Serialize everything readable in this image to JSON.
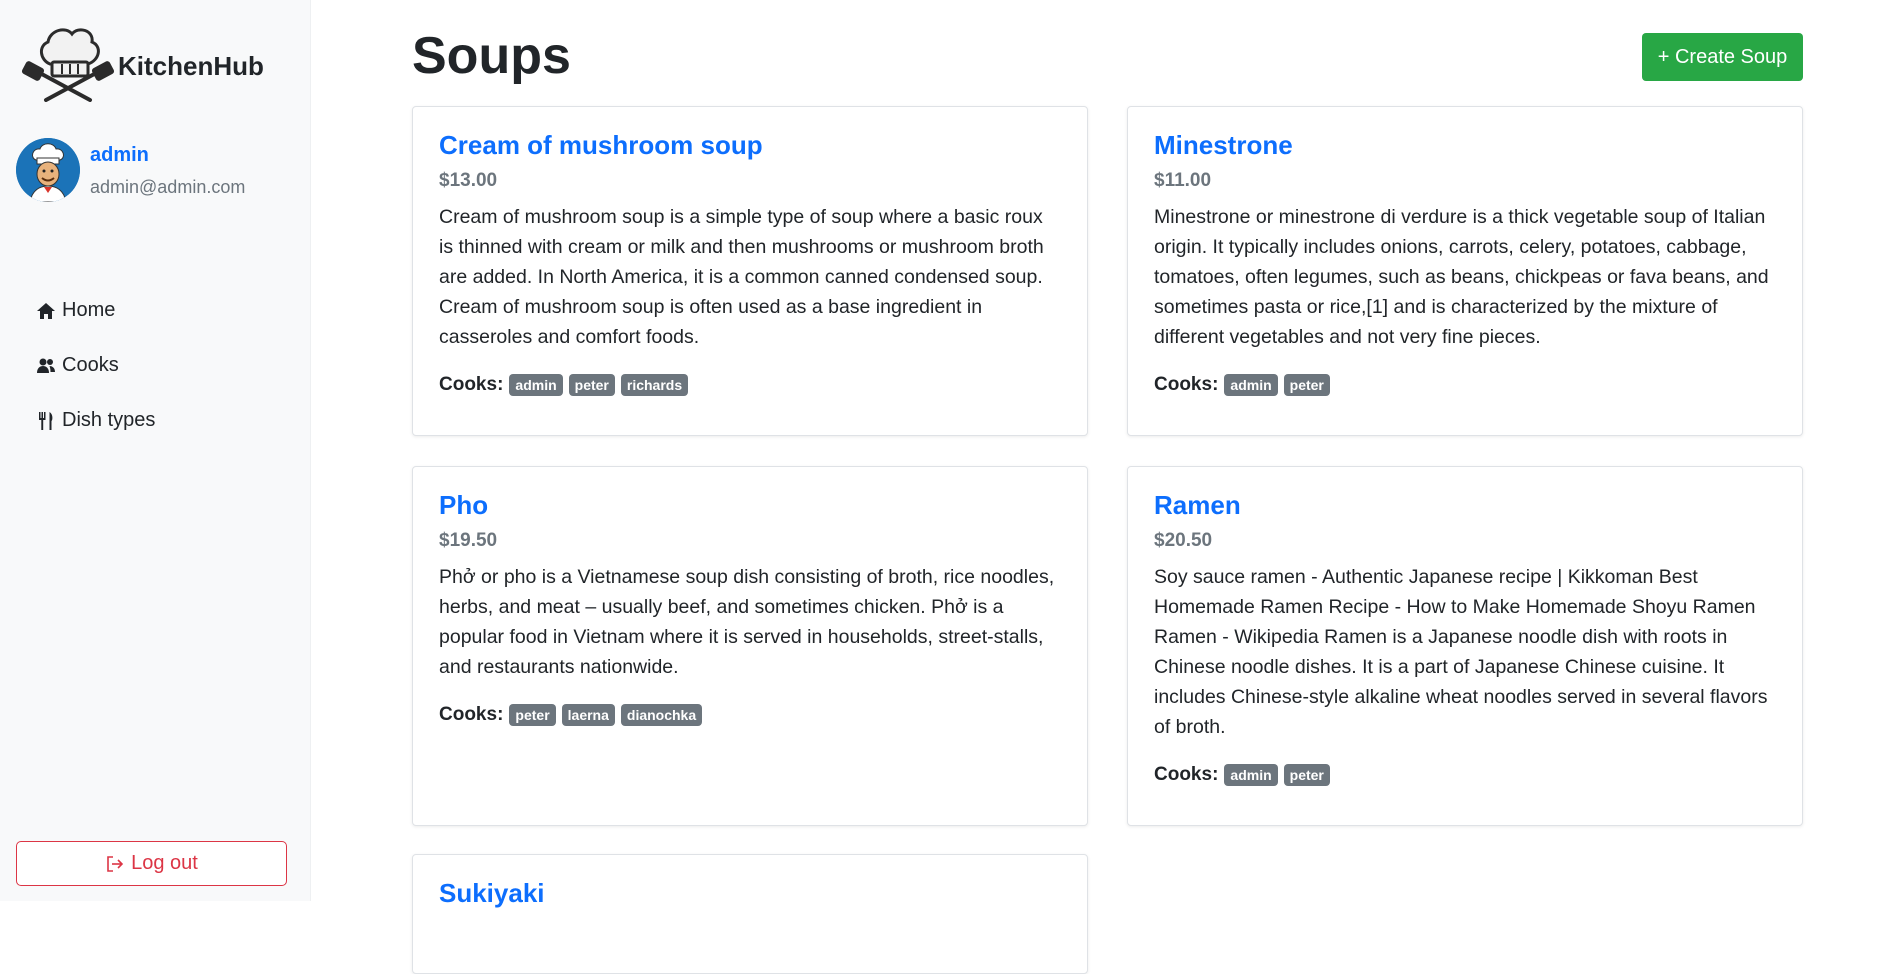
{
  "brand": {
    "name": "KitchenHub"
  },
  "user": {
    "name": "admin",
    "email": "admin@admin.com"
  },
  "nav": [
    {
      "label": "Home",
      "icon": "home-icon"
    },
    {
      "label": "Cooks",
      "icon": "users-icon"
    },
    {
      "label": "Dish types",
      "icon": "utensils-icon"
    }
  ],
  "logout": {
    "label": "Log out"
  },
  "page": {
    "title": "Soups",
    "create_label": "+ Create Soup"
  },
  "cooks_label": "Cooks:",
  "colors": {
    "primary": "#0d6efd",
    "success": "#28a745",
    "danger": "#dc3545",
    "secondary": "#6c757d"
  },
  "dishes": [
    {
      "name": "Cream of mushroom soup",
      "price": "$13.00",
      "description": "Cream of mushroom soup is a simple type of soup where a basic roux is thinned with cream or milk and then mushrooms or mushroom broth are added. In North America, it is a common canned condensed soup. Cream of mushroom soup is often used as a base ingredient in casseroles and comfort foods.",
      "cooks": [
        "admin",
        "peter",
        "richards"
      ]
    },
    {
      "name": "Minestrone",
      "price": "$11.00",
      "description": "Minestrone or minestrone di verdure is a thick vegetable soup of Italian origin. It typically includes onions, carrots, celery, potatoes, cabbage, tomatoes, often legumes, such as beans, chickpeas or fava beans, and sometimes pasta or rice,[1] and is characterized by the mixture of different vegetables and not very fine pieces.",
      "cooks": [
        "admin",
        "peter"
      ]
    },
    {
      "name": "Pho",
      "price": "$19.50",
      "description": "Phở or pho is a Vietnamese soup dish consisting of broth, rice noodles, herbs, and meat – usually beef, and sometimes chicken. Phở is a popular food in Vietnam where it is served in households, street-stalls, and restaurants nationwide.",
      "cooks": [
        "peter",
        "laerna",
        "dianochka"
      ]
    },
    {
      "name": "Ramen",
      "price": "$20.50",
      "description": "Soy sauce ramen - Authentic Japanese recipe | Kikkoman Best Homemade Ramen Recipe - How to Make Homemade Shoyu Ramen Ramen - Wikipedia Ramen is a Japanese noodle dish with roots in Chinese noodle dishes. It is a part of Japanese Chinese cuisine. It includes Chinese-style alkaline wheat noodles served in several flavors of broth.",
      "cooks": [
        "admin",
        "peter"
      ]
    },
    {
      "name": "Sukiyaki",
      "price": "",
      "description": "",
      "cooks": []
    }
  ]
}
